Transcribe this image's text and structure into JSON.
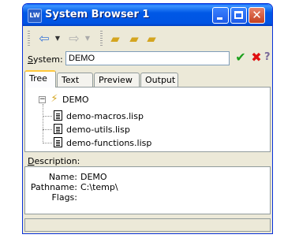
{
  "window": {
    "title": "System Browser 1",
    "icon": "lw-app-icon"
  },
  "title_buttons": {
    "minimize": "minimize-icon",
    "maximize": "maximize-icon",
    "close": "close-icon"
  },
  "toolbar": {
    "back": "back-arrow-icon",
    "forward": "forward-arrow-icon",
    "folder_buttons": [
      "folder-up-icon",
      "folder-open-icon",
      "folder-new-icon"
    ]
  },
  "system": {
    "label_underlined": "S",
    "label_rest": "ystem:",
    "value": "DEMO"
  },
  "field_actions": {
    "ok": "checkmark-icon",
    "cancel": "red-x-icon",
    "help": "help-icon"
  },
  "tabs": [
    "Tree",
    "Text",
    "Preview",
    "Output"
  ],
  "active_tab": "Tree",
  "tree": {
    "root": {
      "label": "DEMO",
      "expander": "⊟"
    },
    "children": [
      "demo-macros.lisp",
      "demo-utils.lisp",
      "demo-functions.lisp"
    ]
  },
  "description": {
    "label_underlined": "D",
    "label_rest": "escription:",
    "name_key": "Name:",
    "name_value": "DEMO",
    "pathname_key": "Pathname:",
    "pathname_value": "C:\\temp\\",
    "flags_key": "Flags:",
    "flags_value": ""
  },
  "status_text": "",
  "colors": {
    "titlebar": "#0054e3",
    "window_bg": "#ece9d8",
    "tab_highlight": "#ffc83c"
  }
}
